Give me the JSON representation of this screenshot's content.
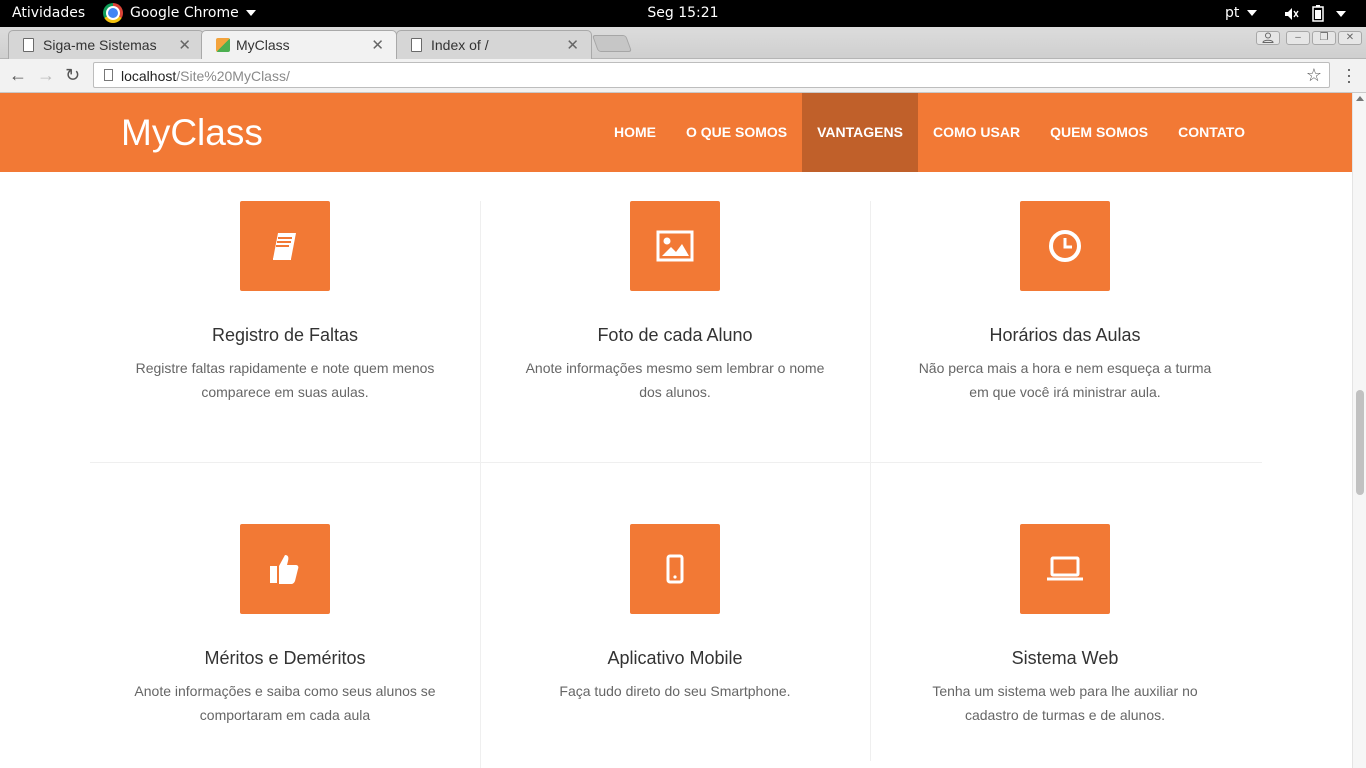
{
  "system_bar": {
    "activities": "Atividades",
    "app_name": "Google Chrome",
    "clock": "Seg 15:21",
    "language": "pt"
  },
  "browser": {
    "tabs": [
      {
        "title": "Siga-me Sistemas",
        "active": false
      },
      {
        "title": "MyClass",
        "active": true
      },
      {
        "title": "Index of /",
        "active": false
      }
    ],
    "url_host": "localhost",
    "url_path": "/Site%20MyClass/"
  },
  "site": {
    "brand": "MyClass",
    "nav": [
      {
        "label": "HOME",
        "active": false
      },
      {
        "label": "O QUE SOMOS",
        "active": false
      },
      {
        "label": "VANTAGENS",
        "active": true
      },
      {
        "label": "COMO USAR",
        "active": false
      },
      {
        "label": "QUEM SOMOS",
        "active": false
      },
      {
        "label": "CONTATO",
        "active": false
      }
    ],
    "features": [
      {
        "icon": "book-icon",
        "title": "Registro de Faltas",
        "text": "Registre faltas rapidamente e note quem menos comparece em suas aulas."
      },
      {
        "icon": "image-icon",
        "title": "Foto de cada Aluno",
        "text": "Anote informações mesmo sem lembrar o nome dos alunos."
      },
      {
        "icon": "clock-icon",
        "title": "Horários das Aulas",
        "text": "Não perca mais a hora e nem esqueça a turma em que você irá ministrar aula."
      },
      {
        "icon": "thumbs-up-icon",
        "title": "Méritos e Deméritos",
        "text": "Anote informações e saiba como seus alunos se comportaram em cada aula"
      },
      {
        "icon": "mobile-phone-icon",
        "title": "Aplicativo Mobile",
        "text": "Faça tudo direto do seu Smartphone."
      },
      {
        "icon": "laptop-icon",
        "title": "Sistema Web",
        "text": "Tenha um sistema web para lhe auxiliar no cadastro de turmas e de alunos."
      }
    ]
  },
  "colors": {
    "accent": "#f27935",
    "accent_active": "#c0602a"
  }
}
